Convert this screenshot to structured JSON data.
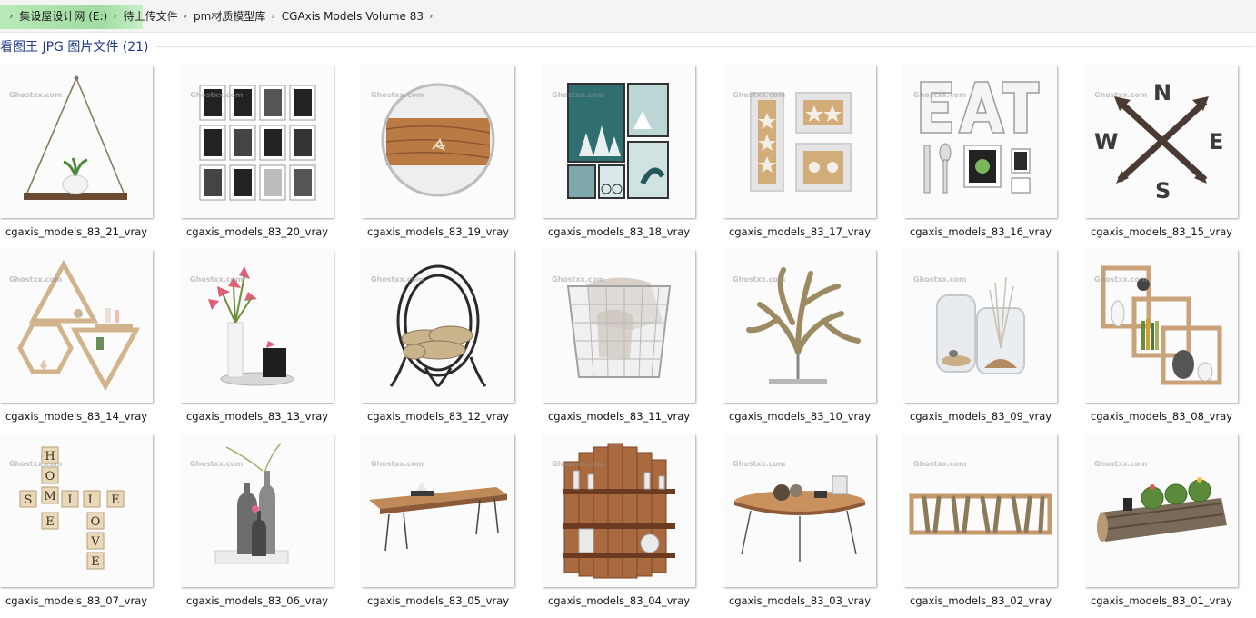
{
  "breadcrumb": {
    "items": [
      "集设屋设计网 (E:)",
      "待上传文件",
      "pm材质模型库",
      "CGAxis Models Volume 83"
    ]
  },
  "group": {
    "title": "看图王 JPG 图片文件 (21)"
  },
  "files": [
    {
      "name": "cgaxis_models_83_21_vray",
      "icon": "hanging-shelf-thumb"
    },
    {
      "name": "cgaxis_models_83_20_vray",
      "icon": "photo-frames-thumb"
    },
    {
      "name": "cgaxis_models_83_19_vray",
      "icon": "round-wood-mirror-thumb"
    },
    {
      "name": "cgaxis_models_83_18_vray",
      "icon": "winter-frames-thumb"
    },
    {
      "name": "cgaxis_models_83_17_vray",
      "icon": "starfish-frames-thumb"
    },
    {
      "name": "cgaxis_models_83_16_vray",
      "icon": "eat-letters-thumb"
    },
    {
      "name": "cgaxis_models_83_15_vray",
      "icon": "compass-decor-thumb"
    },
    {
      "name": "cgaxis_models_83_14_vray",
      "icon": "geometric-shelves-thumb"
    },
    {
      "name": "cgaxis_models_83_13_vray",
      "icon": "lily-vase-thumb"
    },
    {
      "name": "cgaxis_models_83_12_vray",
      "icon": "log-holder-thumb"
    },
    {
      "name": "cgaxis_models_83_11_vray",
      "icon": "wire-basket-thumb"
    },
    {
      "name": "cgaxis_models_83_10_vray",
      "icon": "driftwood-sculpture-thumb"
    },
    {
      "name": "cgaxis_models_83_09_vray",
      "icon": "glass-jars-thumb"
    },
    {
      "name": "cgaxis_models_83_08_vray",
      "icon": "box-shelves-thumb"
    },
    {
      "name": "cgaxis_models_83_07_vray",
      "icon": "letter-tiles-thumb"
    },
    {
      "name": "cgaxis_models_83_06_vray",
      "icon": "bottle-vases-thumb"
    },
    {
      "name": "cgaxis_models_83_05_vray",
      "icon": "wood-coffee-table-thumb"
    },
    {
      "name": "cgaxis_models_83_04_vray",
      "icon": "wood-wall-shelf-thumb"
    },
    {
      "name": "cgaxis_models_83_03_vray",
      "icon": "round-coffee-table-thumb"
    },
    {
      "name": "cgaxis_models_83_02_vray",
      "icon": "branch-shelf-thumb"
    },
    {
      "name": "cgaxis_models_83_01_vray",
      "icon": "cactus-log-thumb"
    }
  ],
  "watermark": "Ghostxx.com",
  "colors": {
    "group_title": "#1e3a8a",
    "breadcrumb_highlight": "#9fdc9f"
  }
}
